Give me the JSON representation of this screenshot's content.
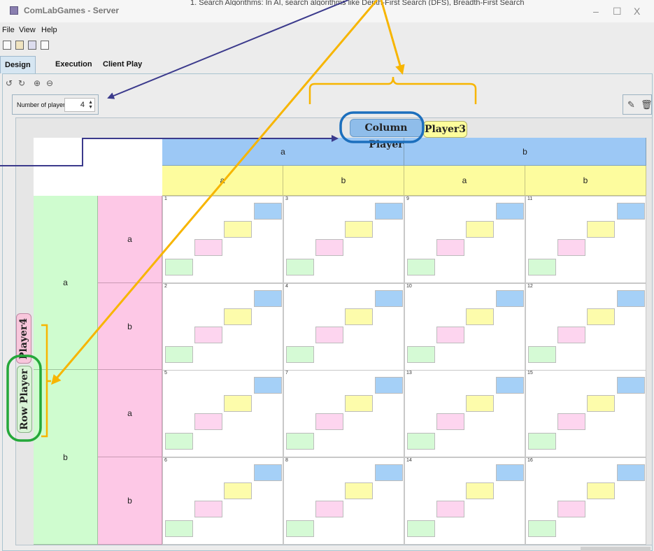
{
  "window": {
    "title": "ComLabGames - Server",
    "background_text": "1. Search Algorithms: In AI, search algorithms like Depth-First Search (DFS), Breadth-First Search",
    "minimize": "–",
    "maximize": "☐",
    "close": "X"
  },
  "menu": {
    "items": [
      "File",
      "View",
      "Help"
    ]
  },
  "tabs": [
    {
      "label": "Design",
      "active": true
    },
    {
      "label": "Execution",
      "active": false
    },
    {
      "label": "Client Play",
      "active": false
    }
  ],
  "players_control": {
    "label": "Number of players",
    "value": "4"
  },
  "column_player": {
    "label": "Column Player",
    "player": "Player3"
  },
  "row_player": {
    "label": "Row Player",
    "player": "Player4"
  },
  "col_headers": {
    "level1": [
      "a",
      "b"
    ],
    "level2": [
      "a",
      "b",
      "a",
      "b"
    ]
  },
  "row_headers": {
    "level1": [
      "a",
      "b"
    ],
    "level2": [
      "a",
      "b",
      "a",
      "b"
    ]
  },
  "payoff_numbers": [
    [
      "1",
      "3",
      "9",
      "11"
    ],
    [
      "2",
      "4",
      "10",
      "12"
    ],
    [
      "5",
      "7",
      "13",
      "15"
    ],
    [
      "6",
      "8",
      "14",
      "16"
    ]
  ],
  "colors": {
    "blue": "#9cc8f5",
    "yellow": "#fdfc9e",
    "pink": "#fdc8e6",
    "green": "#cffccf",
    "arrow_navy": "#3b3a8c",
    "arrow_gold": "#f7b500",
    "highlight_blue": "#1c6fbd",
    "highlight_green": "#25a83a"
  }
}
